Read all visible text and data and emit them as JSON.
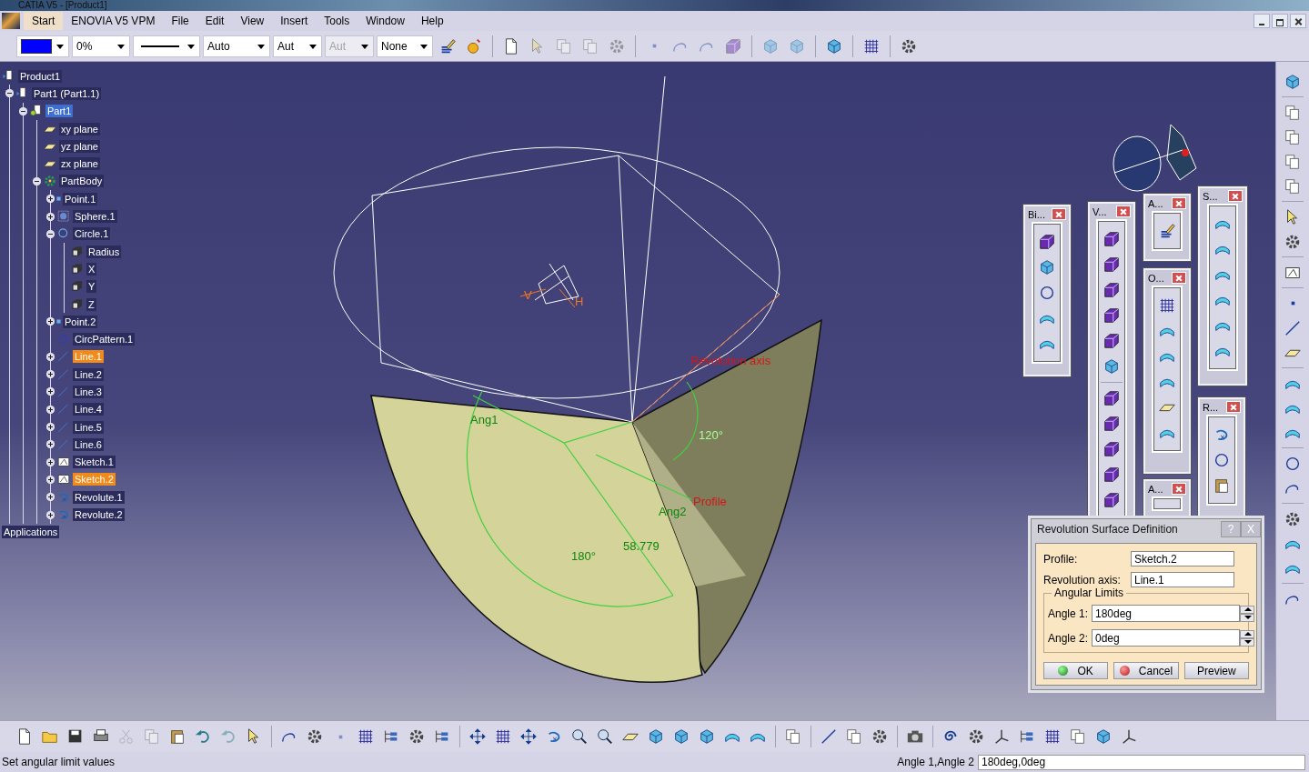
{
  "window": {
    "title": "CATIA V5 - [Product1]"
  },
  "menu": [
    {
      "label": "Start",
      "selected": true
    },
    {
      "label": "ENOVIA V5 VPM",
      "selected": false
    },
    {
      "label": "File",
      "selected": false
    },
    {
      "label": "Edit",
      "selected": false
    },
    {
      "label": "View",
      "selected": false
    },
    {
      "label": "Insert",
      "selected": false
    },
    {
      "label": "Tools",
      "selected": false
    },
    {
      "label": "Window",
      "selected": false
    },
    {
      "label": "Help",
      "selected": false
    }
  ],
  "toolbar": {
    "dropdowns": [
      {
        "kind": "color",
        "color": "#0000ff"
      },
      {
        "kind": "text",
        "value": "0%",
        "disabled": false
      },
      {
        "kind": "linetype"
      },
      {
        "kind": "text",
        "value": "Auto",
        "disabled": false
      },
      {
        "kind": "text",
        "value": "Aut",
        "disabled": false
      },
      {
        "kind": "text",
        "value": "Aut",
        "disabled": true
      },
      {
        "kind": "text",
        "value": "None",
        "disabled": false
      }
    ]
  },
  "tree": [
    {
      "label": "Product1",
      "kind": "product",
      "selected": false,
      "highlighted": false,
      "children": [
        {
          "label": "Part1 (Part1.1)",
          "kind": "product",
          "selected": false,
          "highlighted": false,
          "expanded": true,
          "children": [
            {
              "label": "Part1",
              "kind": "part",
              "selected": true,
              "highlighted": false,
              "expanded": true,
              "children": [
                {
                  "label": "xy plane",
                  "kind": "plane",
                  "selected": false,
                  "highlighted": false
                },
                {
                  "label": "yz plane",
                  "kind": "plane",
                  "selected": false,
                  "highlighted": false
                },
                {
                  "label": "zx plane",
                  "kind": "plane",
                  "selected": false,
                  "highlighted": false
                },
                {
                  "label": "PartBody",
                  "kind": "body",
                  "selected": false,
                  "highlighted": false,
                  "expanded": true,
                  "children": [
                    {
                      "label": "Point.1",
                      "kind": "point",
                      "selected": false,
                      "highlighted": false,
                      "expanded": false
                    },
                    {
                      "label": "Sphere.1",
                      "kind": "sphere",
                      "selected": false,
                      "highlighted": false,
                      "expanded": false
                    },
                    {
                      "label": "Circle.1",
                      "kind": "circle",
                      "selected": false,
                      "highlighted": false,
                      "expanded": true,
                      "children": [
                        {
                          "label": "Radius",
                          "kind": "parameter",
                          "selected": false,
                          "highlighted": false
                        },
                        {
                          "label": "X",
                          "kind": "parameter",
                          "selected": false,
                          "highlighted": false
                        },
                        {
                          "label": "Y",
                          "kind": "parameter",
                          "selected": false,
                          "highlighted": false
                        },
                        {
                          "label": "Z",
                          "kind": "parameter",
                          "selected": false,
                          "highlighted": false
                        }
                      ]
                    },
                    {
                      "label": "Point.2",
                      "kind": "point",
                      "selected": false,
                      "highlighted": false,
                      "expanded": false
                    },
                    {
                      "label": "CircPattern.1",
                      "kind": "pattern",
                      "selected": false,
                      "highlighted": false
                    },
                    {
                      "label": "Line.1",
                      "kind": "line",
                      "selected": false,
                      "highlighted": true,
                      "expanded": false
                    },
                    {
                      "label": "Line.2",
                      "kind": "line",
                      "selected": false,
                      "highlighted": false,
                      "expanded": false
                    },
                    {
                      "label": "Line.3",
                      "kind": "line",
                      "selected": false,
                      "highlighted": false,
                      "expanded": false
                    },
                    {
                      "label": "Line.4",
                      "kind": "line",
                      "selected": false,
                      "highlighted": false,
                      "expanded": false
                    },
                    {
                      "label": "Line.5",
                      "kind": "line",
                      "selected": false,
                      "highlighted": false,
                      "expanded": false
                    },
                    {
                      "label": "Line.6",
                      "kind": "line",
                      "selected": false,
                      "highlighted": false,
                      "expanded": false
                    },
                    {
                      "label": "Sketch.1",
                      "kind": "sketch",
                      "selected": false,
                      "highlighted": false,
                      "expanded": false
                    },
                    {
                      "label": "Sketch.2",
                      "kind": "sketch",
                      "selected": false,
                      "highlighted": true,
                      "expanded": false
                    },
                    {
                      "label": "Revolute.1",
                      "kind": "revolute",
                      "selected": false,
                      "highlighted": false,
                      "expanded": false
                    },
                    {
                      "label": "Revolute.2",
                      "kind": "revolute",
                      "selected": false,
                      "highlighted": false,
                      "expanded": false
                    }
                  ]
                }
              ]
            }
          ]
        }
      ]
    },
    {
      "label": "Applications",
      "kind": "applications",
      "selected": false,
      "highlighted": false
    }
  ],
  "annotations": [
    {
      "text": "Revolution axis",
      "kind": "axis-label"
    },
    {
      "text": "Profile",
      "kind": "axis-label"
    },
    {
      "text": "Ang1",
      "kind": "dimension"
    },
    {
      "text": "Ang2",
      "kind": "dimension"
    },
    {
      "text": "120°",
      "kind": "dimension"
    },
    {
      "text": "180°",
      "kind": "dimension"
    },
    {
      "text": "58.779",
      "kind": "dimension"
    },
    {
      "text": "H",
      "kind": "compass-letter"
    },
    {
      "text": "V",
      "kind": "compass-letter"
    }
  ],
  "floating_toolbars": [
    {
      "title": "Bi..."
    },
    {
      "title": "V..."
    },
    {
      "title": "A..."
    },
    {
      "title": "O..."
    },
    {
      "title": "S..."
    },
    {
      "title": "R..."
    },
    {
      "title": "A..."
    }
  ],
  "dialog": {
    "title": "Revolution Surface Definition",
    "help": "?",
    "close": "X",
    "fields": [
      {
        "label": "Profile:",
        "value": "Sketch.2"
      },
      {
        "label": "Revolution axis:",
        "value": "Line.1"
      }
    ],
    "group": {
      "title": "Angular Limits",
      "spinners": [
        {
          "label": "Angle 1:",
          "value": "180deg"
        },
        {
          "label": "Angle 2:",
          "value": "0deg"
        }
      ]
    },
    "buttons": [
      {
        "label": "OK",
        "kind": "ok"
      },
      {
        "label": "Cancel",
        "kind": "cancel"
      },
      {
        "label": "Preview",
        "kind": "plain"
      }
    ]
  },
  "status_bar": {
    "message": "Set angular limit values",
    "input_label": "Angle 1,Angle 2",
    "input_value": "180deg,0deg"
  }
}
